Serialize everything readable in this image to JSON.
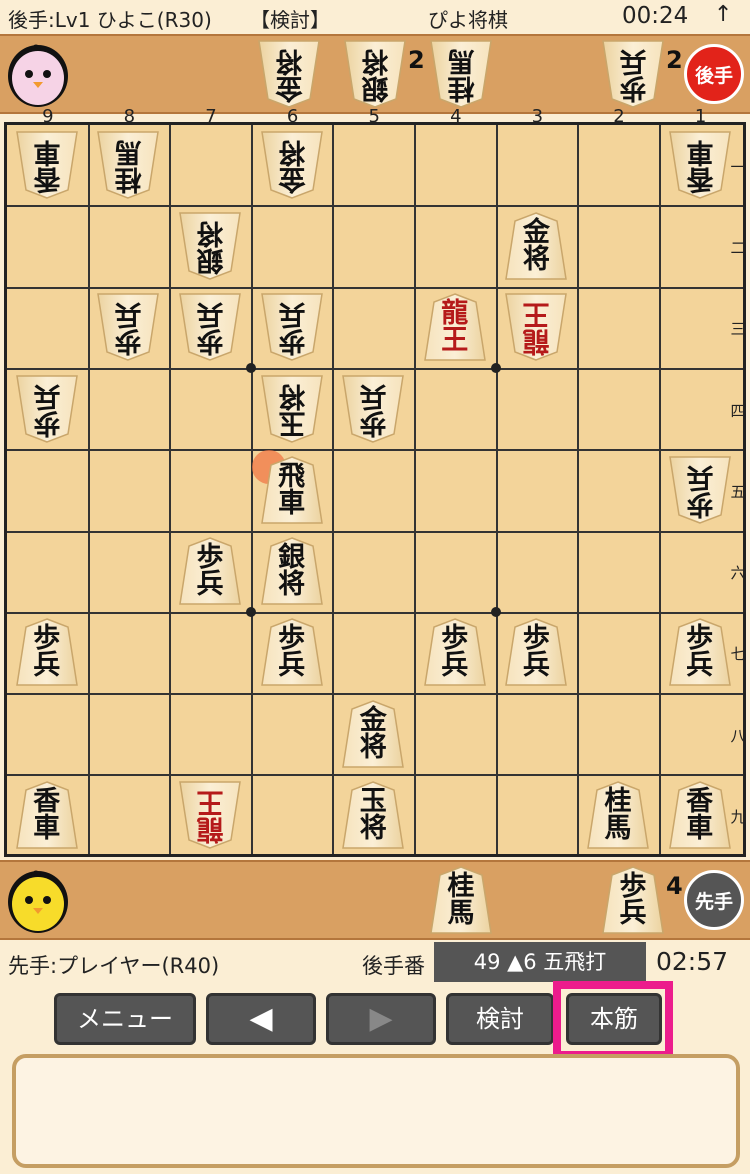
{
  "top_bar": {
    "gote_info": "後手:Lv1 ひよこ(R30)",
    "mode": "【検討】",
    "app_title": "ぴよ将棋",
    "gote_time": "00:24",
    "turn_arrow": "↑"
  },
  "gote_hand": {
    "pieces": [
      {
        "char1": "金",
        "char2": "将",
        "count": ""
      },
      {
        "char1": "銀",
        "char2": "将",
        "count": "2"
      },
      {
        "char1": "桂",
        "char2": "馬",
        "count": ""
      },
      {
        "char1": "歩",
        "char2": "兵",
        "count": "2"
      }
    ],
    "badge": "後手",
    "badge_color": "#e2231a"
  },
  "sente_hand": {
    "pieces": [
      {
        "char1": "桂",
        "char2": "馬",
        "count": ""
      },
      {
        "char1": "歩",
        "char2": "兵",
        "count": "4"
      }
    ],
    "badge": "先手",
    "badge_color": "#555555"
  },
  "board": {
    "col_labels": [
      "9",
      "8",
      "7",
      "6",
      "5",
      "4",
      "3",
      "2",
      "1"
    ],
    "row_labels": [
      "一",
      "二",
      "三",
      "四",
      "五",
      "六",
      "七",
      "八",
      "九"
    ],
    "pieces": [
      {
        "col": 9,
        "row": 1,
        "c1": "香",
        "c2": "車",
        "side": "gote",
        "promoted": false
      },
      {
        "col": 8,
        "row": 1,
        "c1": "桂",
        "c2": "馬",
        "side": "gote",
        "promoted": false
      },
      {
        "col": 6,
        "row": 1,
        "c1": "金",
        "c2": "将",
        "side": "gote",
        "promoted": false
      },
      {
        "col": 1,
        "row": 1,
        "c1": "香",
        "c2": "車",
        "side": "gote",
        "promoted": false
      },
      {
        "col": 7,
        "row": 2,
        "c1": "銀",
        "c2": "将",
        "side": "gote",
        "promoted": false
      },
      {
        "col": 3,
        "row": 2,
        "c1": "金",
        "c2": "将",
        "side": "sente",
        "promoted": false
      },
      {
        "col": 8,
        "row": 3,
        "c1": "歩",
        "c2": "兵",
        "side": "gote",
        "promoted": false
      },
      {
        "col": 7,
        "row": 3,
        "c1": "歩",
        "c2": "兵",
        "side": "gote",
        "promoted": false
      },
      {
        "col": 6,
        "row": 3,
        "c1": "歩",
        "c2": "兵",
        "side": "gote",
        "promoted": false
      },
      {
        "col": 4,
        "row": 3,
        "c1": "龍",
        "c2": "王",
        "side": "sente",
        "promoted": true
      },
      {
        "col": 3,
        "row": 3,
        "c1": "龍",
        "c2": "王",
        "side": "gote",
        "promoted": true
      },
      {
        "col": 9,
        "row": 4,
        "c1": "歩",
        "c2": "兵",
        "side": "gote",
        "promoted": false
      },
      {
        "col": 6,
        "row": 4,
        "c1": "玉",
        "c2": "将",
        "side": "gote",
        "promoted": false
      },
      {
        "col": 5,
        "row": 4,
        "c1": "歩",
        "c2": "兵",
        "side": "gote",
        "promoted": false
      },
      {
        "col": 6,
        "row": 5,
        "c1": "飛",
        "c2": "車",
        "side": "sente",
        "promoted": false
      },
      {
        "col": 1,
        "row": 5,
        "c1": "歩",
        "c2": "兵",
        "side": "gote",
        "promoted": false
      },
      {
        "col": 7,
        "row": 6,
        "c1": "歩",
        "c2": "兵",
        "side": "sente",
        "promoted": false
      },
      {
        "col": 6,
        "row": 6,
        "c1": "銀",
        "c2": "将",
        "side": "sente",
        "promoted": false
      },
      {
        "col": 9,
        "row": 7,
        "c1": "歩",
        "c2": "兵",
        "side": "sente",
        "promoted": false
      },
      {
        "col": 6,
        "row": 7,
        "c1": "歩",
        "c2": "兵",
        "side": "sente",
        "promoted": false
      },
      {
        "col": 4,
        "row": 7,
        "c1": "歩",
        "c2": "兵",
        "side": "sente",
        "promoted": false
      },
      {
        "col": 3,
        "row": 7,
        "c1": "歩",
        "c2": "兵",
        "side": "sente",
        "promoted": false
      },
      {
        "col": 1,
        "row": 7,
        "c1": "歩",
        "c2": "兵",
        "side": "sente",
        "promoted": false
      },
      {
        "col": 5,
        "row": 8,
        "c1": "金",
        "c2": "将",
        "side": "sente",
        "promoted": false
      },
      {
        "col": 9,
        "row": 9,
        "c1": "香",
        "c2": "車",
        "side": "sente",
        "promoted": false
      },
      {
        "col": 7,
        "row": 9,
        "c1": "龍",
        "c2": "王",
        "side": "gote",
        "promoted": true
      },
      {
        "col": 5,
        "row": 9,
        "c1": "玉",
        "c2": "将",
        "side": "sente",
        "promoted": false
      },
      {
        "col": 2,
        "row": 9,
        "c1": "桂",
        "c2": "馬",
        "side": "sente",
        "promoted": false
      },
      {
        "col": 1,
        "row": 9,
        "c1": "香",
        "c2": "車",
        "side": "sente",
        "promoted": false
      }
    ],
    "last_move_square": {
      "col": 6,
      "row": 5
    }
  },
  "info_bar": {
    "sente_info": "先手:プレイヤー(R40)",
    "turn_label": "後手番",
    "move_display": "49 ▲6 五飛打",
    "sente_time": "02:57"
  },
  "buttons": {
    "menu": "メニュー",
    "prev": "◀",
    "next": "▶",
    "kento": "検討",
    "honsuji": "本筋"
  },
  "highlight_color": "#ec1c8c",
  "message": ""
}
